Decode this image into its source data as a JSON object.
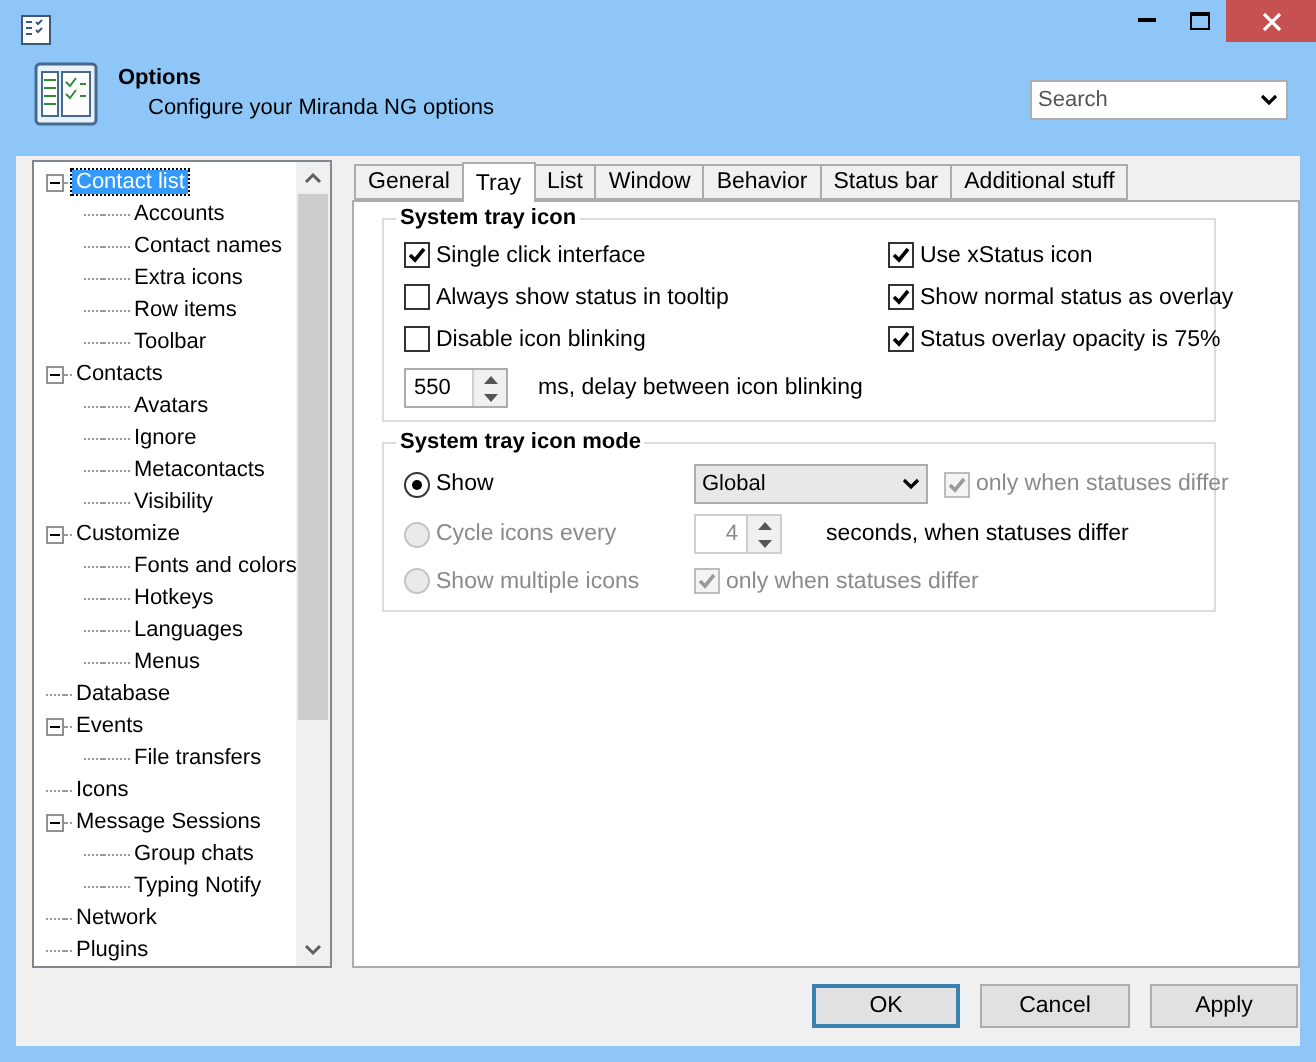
{
  "header": {
    "title": "Options",
    "subtitle": "Configure your Miranda NG options",
    "search": {
      "placeholder": "Search"
    }
  },
  "tree": [
    {
      "label": "Contact list",
      "selected": true,
      "expanded": true,
      "children": [
        {
          "label": "Accounts",
          "selected": false
        },
        {
          "label": "Contact names",
          "selected": false
        },
        {
          "label": "Extra icons",
          "selected": false
        },
        {
          "label": "Row items",
          "selected": false
        },
        {
          "label": "Toolbar",
          "selected": false
        }
      ]
    },
    {
      "label": "Contacts",
      "selected": false,
      "expanded": true,
      "children": [
        {
          "label": "Avatars",
          "selected": false
        },
        {
          "label": "Ignore",
          "selected": false
        },
        {
          "label": "Metacontacts",
          "selected": false
        },
        {
          "label": "Visibility",
          "selected": false
        }
      ]
    },
    {
      "label": "Customize",
      "selected": false,
      "expanded": true,
      "children": [
        {
          "label": "Fonts and colors",
          "selected": false
        },
        {
          "label": "Hotkeys",
          "selected": false
        },
        {
          "label": "Languages",
          "selected": false
        },
        {
          "label": "Menus",
          "selected": false
        }
      ]
    },
    {
      "label": "Database",
      "selected": false
    },
    {
      "label": "Events",
      "selected": false,
      "expanded": true,
      "children": [
        {
          "label": "File transfers",
          "selected": false
        }
      ]
    },
    {
      "label": "Icons",
      "selected": false
    },
    {
      "label": "Message Sessions",
      "selected": false,
      "expanded": true,
      "children": [
        {
          "label": "Group chats",
          "selected": false
        },
        {
          "label": "Typing Notify",
          "selected": false
        }
      ]
    },
    {
      "label": "Network",
      "selected": false
    },
    {
      "label": "Plugins",
      "selected": false
    }
  ],
  "tabs": [
    {
      "label": "General",
      "selected": false
    },
    {
      "label": "Tray",
      "selected": true
    },
    {
      "label": "List",
      "selected": false
    },
    {
      "label": "Window",
      "selected": false
    },
    {
      "label": "Behavior",
      "selected": false
    },
    {
      "label": "Status bar",
      "selected": false
    },
    {
      "label": "Additional stuff",
      "selected": false
    }
  ],
  "tray_icon": {
    "title": "System tray icon",
    "left_options": [
      {
        "label": "Single click interface",
        "checked": true
      },
      {
        "label": "Always show status in tooltip",
        "checked": false
      },
      {
        "label": "Disable icon blinking",
        "checked": false
      }
    ],
    "right_options": [
      {
        "label": "Use xStatus icon",
        "checked": true
      },
      {
        "label": "Show normal status as overlay",
        "checked": true
      },
      {
        "label": "Status overlay opacity is 75%",
        "checked": true
      }
    ],
    "delay": {
      "value": "550",
      "label": "ms, delay between icon blinking"
    }
  },
  "tray_mode": {
    "title": "System tray icon mode",
    "show": {
      "label": "Show",
      "selected": true,
      "disabled": false,
      "dropdown": "Global",
      "option": {
        "label": "only when statuses differ",
        "checked": true,
        "disabled": true
      }
    },
    "cycle": {
      "label": "Cycle icons every",
      "selected": false,
      "disabled": true,
      "value": "4",
      "suffix": "seconds, when statuses differ"
    },
    "multiple": {
      "label": "Show multiple icons",
      "selected": false,
      "disabled": true,
      "option": {
        "label": "only when statuses differ",
        "checked": true,
        "disabled": true
      }
    }
  },
  "buttons": [
    {
      "label": "OK",
      "selected": true
    },
    {
      "label": "Cancel",
      "selected": false
    },
    {
      "label": "Apply",
      "selected": false
    }
  ]
}
